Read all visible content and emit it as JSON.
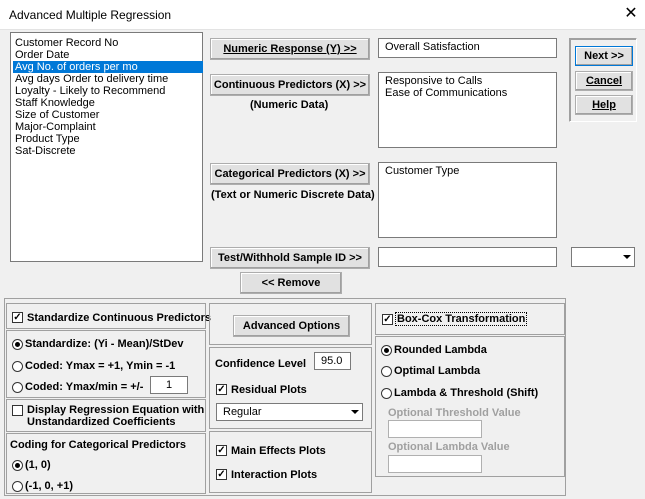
{
  "window": {
    "title": "Advanced Multiple Regression",
    "close_glyph": "✕"
  },
  "variables_list": {
    "items": [
      "Customer Record No",
      "Order Date",
      "Avg No. of orders per mo",
      "Avg days Order to delivery time",
      "Loyalty - Likely to Recommend",
      "Staff Knowledge",
      "Size of Customer",
      "Major-Complaint",
      "Product Type",
      "Sat-Discrete"
    ],
    "selected": "Avg No. of orders per mo"
  },
  "numeric_response": {
    "button_label": "Numeric Response (Y) >>",
    "value": "Overall Satisfaction"
  },
  "continuous_predictors": {
    "button_label": "Continuous Predictors (X) >>",
    "sublabel": "(Numeric Data)",
    "values": [
      "Responsive to Calls",
      "Ease of Communications"
    ]
  },
  "categorical_predictors": {
    "button_label": "Categorical Predictors (X) >>",
    "sublabel": "(Text or Numeric Discrete Data)",
    "values": [
      "Customer Type"
    ]
  },
  "test_withhold": {
    "button_label": "Test/Withhold Sample ID >>",
    "value": "",
    "combo_value": ""
  },
  "remove_button": "<< Remove",
  "side_buttons": {
    "next": "Next >>",
    "cancel": "Cancel",
    "help": "Help"
  },
  "standardize": {
    "checkbox_label": "Standardize Continuous Predictors",
    "checked": true,
    "options": [
      {
        "label": "Standardize: (Yi - Mean)/StDev",
        "selected": true
      },
      {
        "label": "Coded: Ymax = +1, Ymin = -1",
        "selected": false
      },
      {
        "label": "Coded: Ymax/min = +/-",
        "selected": false
      }
    ],
    "coded_value": "1"
  },
  "display_equation": {
    "line1": "Display Regression Equation with",
    "line2": "Unstandardized Coefficients",
    "checked": false
  },
  "coding": {
    "title": "Coding for Categorical Predictors",
    "options": [
      {
        "label": "(1, 0)",
        "selected": true
      },
      {
        "label": "(-1, 0, +1)",
        "selected": false
      }
    ]
  },
  "advanced_options_button": "Advanced Options",
  "confidence_level": {
    "label": "Confidence Level",
    "value": "95.0"
  },
  "residual_plots": {
    "label": "Residual Plots",
    "checked": true,
    "select_value": "Regular"
  },
  "main_effects_plots": {
    "label": "Main Effects Plots",
    "checked": true
  },
  "interaction_plots": {
    "label": "Interaction Plots",
    "checked": true
  },
  "boxcox": {
    "label": "Box-Cox Transformation",
    "checked": true,
    "options": [
      {
        "label": "Rounded Lambda",
        "selected": true
      },
      {
        "label": "Optimal Lambda",
        "selected": false
      },
      {
        "label": "Lambda & Threshold (Shift)",
        "selected": false
      }
    ],
    "threshold_label": "Optional Threshold Value",
    "lambda_label": "Optional Lambda Value",
    "threshold_value": "",
    "lambda_value": ""
  }
}
